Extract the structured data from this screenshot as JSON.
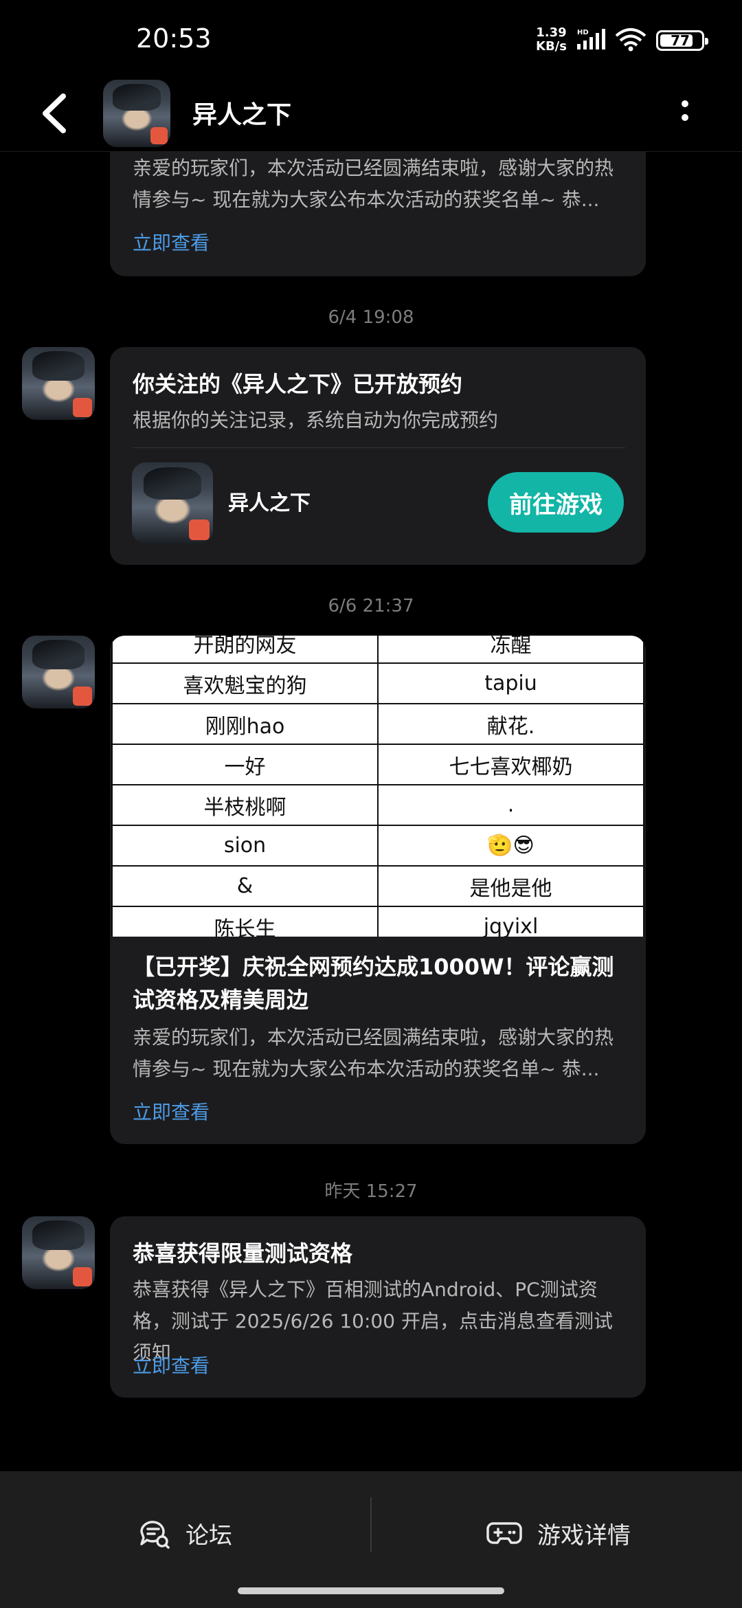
{
  "status": {
    "time": "20:53",
    "net_speed": "1.39",
    "net_unit": "KB/s",
    "hd": "HD",
    "battery": "77"
  },
  "header": {
    "back_icon": "back-arrow-icon",
    "title": "异人之下",
    "more_icon": "more-vertical-icon"
  },
  "messages": [
    {
      "body": "亲爱的玩家们，本次活动已经圆满结束啦，感谢大家的热情参与~ 现在就为大家公布本次活动的获奖名单~ 恭...",
      "link": "立即查看"
    },
    {
      "timestamp": "6/4  19:08",
      "title": "你关注的《异人之下》已开放预约",
      "body": "根据你的关注记录，系统自动为你完成预约",
      "game_name": "异人之下",
      "button": "前往游戏"
    },
    {
      "timestamp": "6/6  21:37",
      "table_rows": [
        [
          "开朗的网友",
          "冻醒"
        ],
        [
          "喜欢魁宝的狗",
          "tapiu"
        ],
        [
          "刚刚hao",
          "献花."
        ],
        [
          "一好",
          "七七喜欢椰奶"
        ],
        [
          "半枝桃啊",
          "."
        ],
        [
          "sion",
          "🫡😎"
        ],
        [
          "&",
          "是他是他"
        ],
        [
          "陈长生",
          "jqyixl"
        ]
      ],
      "title": "【已开奖】庆祝全网预约达成1000W！评论赢测试资格及精美周边",
      "body": "亲爱的玩家们，本次活动已经圆满结束啦，感谢大家的热情参与~ 现在就为大家公布本次活动的获奖名单~ 恭...",
      "link": "立即查看"
    },
    {
      "timestamp": "昨天  15:27",
      "title": "恭喜获得限量测试资格",
      "body": "恭喜获得《异人之下》百相测试的Android、PC测试资格，测试于 2025/6/26 10:00 开启，点击消息查看测试须知",
      "link": "立即查看"
    }
  ],
  "bottom_tabs": [
    {
      "label": "论坛",
      "icon": "forum-chat-icon"
    },
    {
      "label": "游戏详情",
      "icon": "gamepad-icon"
    }
  ],
  "colors": {
    "accent_teal": "#12b5a6",
    "link_blue": "#4d9be6",
    "card_bg": "#1c1c1e"
  }
}
